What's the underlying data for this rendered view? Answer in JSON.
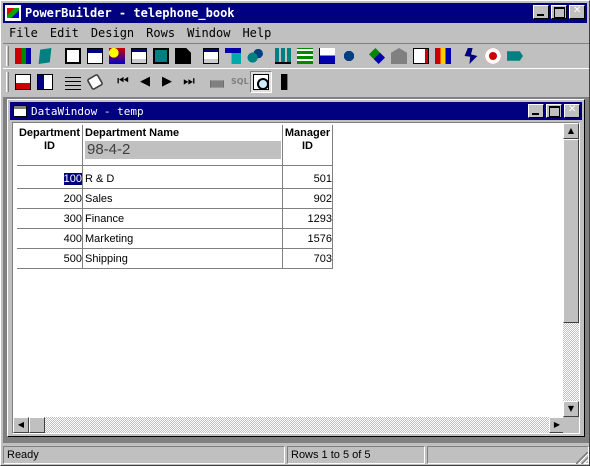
{
  "window": {
    "title": "PowerBuilder - telephone_book"
  },
  "menu": [
    "File",
    "Edit",
    "Design",
    "Rows",
    "Window",
    "Help"
  ],
  "toolbar1_icons": [
    "new-icon",
    "open-icon",
    "library-icon",
    "window-icon",
    "menu-icon",
    "datawindow-icon",
    "structure-icon",
    "function-icon",
    "project-icon",
    "query-icon",
    "pipeline-icon",
    "database-icon",
    "database-profile-icon",
    "report-icon",
    "graph-icon",
    "user-object-icon",
    "library-painter-icon",
    "application-icon",
    "edit-icon",
    "object-browser-icon",
    "run-icon",
    "debug-icon",
    "exit-icon"
  ],
  "toolbar2_icons": [
    "insert-row-icon",
    "delete-row-icon",
    "update-icon",
    "clear-icon",
    "first-page-icon",
    "prior-page-icon",
    "next-page-icon",
    "last-page-icon",
    "print-icon",
    "sql-icon",
    "preview-icon",
    "close-preview-icon"
  ],
  "toolbar2_labels": {
    "sql": "SQL"
  },
  "child": {
    "title": "DataWindow - temp"
  },
  "datawindow": {
    "headers": {
      "dept_id": "Department\nID",
      "dept_name": "Department Name",
      "manager_id": "Manager\nID"
    },
    "argument_value": "98-4-2",
    "rows": [
      {
        "dept_id": "100",
        "dept_name": "R & D",
        "manager_id": "501"
      },
      {
        "dept_id": "200",
        "dept_name": "Sales",
        "manager_id": "902"
      },
      {
        "dept_id": "300",
        "dept_name": "Finance",
        "manager_id": "1293"
      },
      {
        "dept_id": "400",
        "dept_name": "Marketing",
        "manager_id": "1576"
      },
      {
        "dept_id": "500",
        "dept_name": "Shipping",
        "manager_id": "703"
      }
    ]
  },
  "status": {
    "message": "Ready",
    "rows_info": "Rows 1 to 5 of 5",
    "extra": ""
  }
}
